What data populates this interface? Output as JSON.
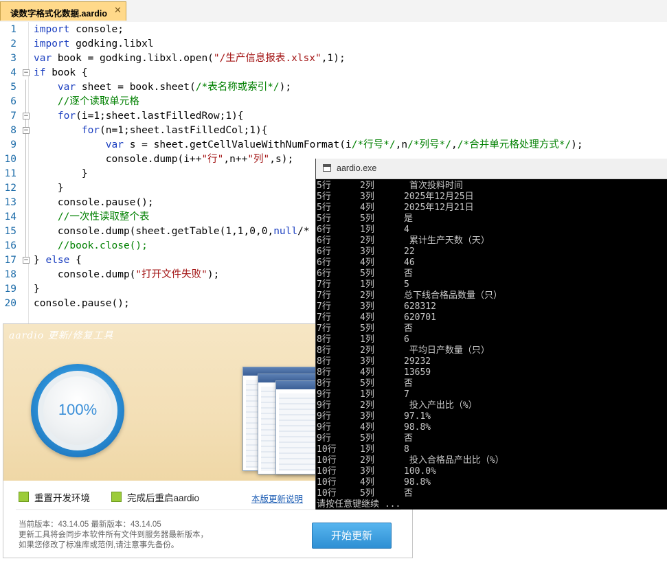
{
  "tab": {
    "title": "读数字格式化数据.aardio",
    "close": "✕"
  },
  "code_lines": [
    {
      "n": "1",
      "html": "<span class=\"kw\">import</span> console;"
    },
    {
      "n": "2",
      "html": "<span class=\"kw\">import</span> godking.libxl"
    },
    {
      "n": "3",
      "html": "<span class=\"kw\">var</span> book = godking.libxl.open(<span class=\"str\">\"/生产信息报表.xlsx\"</span>,1);"
    },
    {
      "n": "4",
      "html": "<span class=\"kw\">if</span> book {"
    },
    {
      "n": "5",
      "html": "    <span class=\"kw\">var</span> sheet = book.sheet(<span class=\"cm\">/*表名称或索引*/</span>);"
    },
    {
      "n": "6",
      "html": "    <span class=\"cm\">//逐个读取单元格</span>"
    },
    {
      "n": "7",
      "html": "    <span class=\"kw\">for</span>(i=1;sheet.lastFilledRow;1){"
    },
    {
      "n": "8",
      "html": "        <span class=\"kw\">for</span>(n=1;sheet.lastFilledCol;1){"
    },
    {
      "n": "9",
      "html": "            <span class=\"kw\">var</span> s = sheet.getCellValueWithNumFormat(i<span class=\"cm\">/*行号*/</span>,n<span class=\"cm\">/*列号*/</span>,<span class=\"cm\">/*合并单元格处理方式*/</span>);"
    },
    {
      "n": "10",
      "html": "            console.dump(i++<span class=\"str\">\"行\"</span>,n++<span class=\"str\">\"列\"</span>,s);"
    },
    {
      "n": "11",
      "html": "        }"
    },
    {
      "n": "12",
      "html": "    }"
    },
    {
      "n": "13",
      "html": "    console.pause();"
    },
    {
      "n": "14",
      "html": "    <span class=\"cm\">//一次性读取整个表</span>"
    },
    {
      "n": "15",
      "html": "    console.dump(sheet.getTable(1,1,0,0,<span class=\"kw\">null</span>/*"
    },
    {
      "n": "16",
      "html": "    <span class=\"cm\">//book.close();</span>"
    },
    {
      "n": "17",
      "html": "} <span class=\"kw\">else</span> {"
    },
    {
      "n": "18",
      "html": "    console.dump(<span class=\"str\">\"打开文件失败\"</span>);"
    },
    {
      "n": "19",
      "html": "}"
    },
    {
      "n": "20",
      "html": "console.pause();"
    }
  ],
  "updater": {
    "title": "aardio 更新/修复工具",
    "progress_label": "100%",
    "progress": 1.0,
    "option1": "重置开发环境",
    "option2": "完成后重启aardio",
    "link": "本版更新说明",
    "version_line": "当前版本：43.14.05 最新版本：43.14.05",
    "info_line1": "更新工具将会同步本软件所有文件到服务器最新版本，",
    "info_line2": "如果您修改了标准库或范例,请注意事先备份。",
    "button": "开始更新"
  },
  "console": {
    "title": "aardio.exe",
    "rows": [
      {
        "r": "5行",
        "c": "2列",
        "v": " 首次投料时间"
      },
      {
        "r": "5行",
        "c": "3列",
        "v": "2025年12月25日"
      },
      {
        "r": "5行",
        "c": "4列",
        "v": "2025年12月21日"
      },
      {
        "r": "5行",
        "c": "5列",
        "v": "是"
      },
      {
        "r": "6行",
        "c": "1列",
        "v": "4"
      },
      {
        "r": "6行",
        "c": "2列",
        "v": " 累计生产天数（天）"
      },
      {
        "r": "6行",
        "c": "3列",
        "v": "22"
      },
      {
        "r": "6行",
        "c": "4列",
        "v": "46"
      },
      {
        "r": "6行",
        "c": "5列",
        "v": "否"
      },
      {
        "r": "7行",
        "c": "1列",
        "v": "5"
      },
      {
        "r": "7行",
        "c": "2列",
        "v": "总下线合格品数量（只）"
      },
      {
        "r": "7行",
        "c": "3列",
        "v": "628312"
      },
      {
        "r": "7行",
        "c": "4列",
        "v": "620701"
      },
      {
        "r": "7行",
        "c": "5列",
        "v": "否"
      },
      {
        "r": "8行",
        "c": "1列",
        "v": "6"
      },
      {
        "r": "8行",
        "c": "2列",
        "v": " 平均日产数量（只）"
      },
      {
        "r": "8行",
        "c": "3列",
        "v": "29232"
      },
      {
        "r": "8行",
        "c": "4列",
        "v": "13659"
      },
      {
        "r": "8行",
        "c": "5列",
        "v": "否"
      },
      {
        "r": "9行",
        "c": "1列",
        "v": "7"
      },
      {
        "r": "9行",
        "c": "2列",
        "v": " 投入产出比（%）"
      },
      {
        "r": "9行",
        "c": "3列",
        "v": "97.1%"
      },
      {
        "r": "9行",
        "c": "4列",
        "v": "98.8%"
      },
      {
        "r": "9行",
        "c": "5列",
        "v": "否"
      },
      {
        "r": "10行",
        "c": "1列",
        "v": "8"
      },
      {
        "r": "10行",
        "c": "2列",
        "v": " 投入合格品产出比（%）"
      },
      {
        "r": "10行",
        "c": "3列",
        "v": "100.0%"
      },
      {
        "r": "10行",
        "c": "4列",
        "v": "98.8%"
      },
      {
        "r": "10行",
        "c": "5列",
        "v": "否"
      }
    ],
    "pause": "请按任意键继续 ..."
  }
}
